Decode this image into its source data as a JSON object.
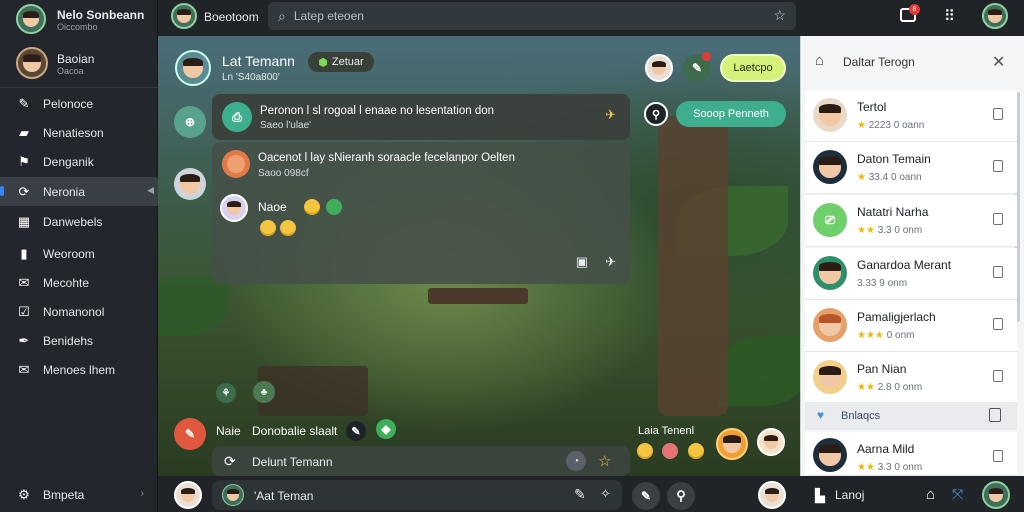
{
  "sidebar": {
    "user": {
      "name": "Nelo Sonbeann",
      "status": "Oiccombo"
    },
    "profile2": {
      "name": "Baoian",
      "sub": "Oacoa"
    },
    "items": [
      {
        "label": "Pelonoce",
        "icon": "feather-icon"
      },
      {
        "label": "Nenatieson",
        "icon": "folder-icon"
      },
      {
        "label": "Denganik",
        "icon": "flag-icon"
      },
      {
        "label": "Neronia",
        "icon": "refresh-icon"
      },
      {
        "label": "Danwebels",
        "icon": "grid-icon"
      },
      {
        "label": "Weoroom",
        "icon": "bookmark-icon"
      },
      {
        "label": "Mecohte",
        "icon": "mail-icon"
      },
      {
        "label": "Nomanonol",
        "icon": "check-icon"
      },
      {
        "label": "Benidehs",
        "icon": "pen-icon"
      },
      {
        "label": "Menoes lhem",
        "icon": "mail-icon"
      }
    ],
    "footer": {
      "label": "Bmpeta"
    }
  },
  "topbar": {
    "user": "Boeotoom",
    "search_placeholder": "Latep eteoen",
    "notification_count": "8"
  },
  "scene": {
    "header": {
      "title": "Lat Temann",
      "subtitle": "Ln 'S40a800'",
      "badge": "Zetuar"
    },
    "action_button": "Laetcpo",
    "secondary_pill": "Sooop Penneth",
    "card1": {
      "title": "Peronon l sl rogoal  l enaae no lesentation don",
      "sub": "Saeo l'ulae'"
    },
    "card2": {
      "title": "Oacenot l lay  sNieranh soraacle fecelanpor Oelten",
      "sub": "Saoo 098cf"
    },
    "card2_emoji_label": "Naoe",
    "chat_row": {
      "name": "Naie",
      "message": "Donobalie slaalt"
    },
    "reply_box": "Delunt Temann",
    "right_label": "Laia Tenenl"
  },
  "rightpanel": {
    "title": "Daltar Terogn",
    "items": [
      {
        "name": "Tertol",
        "stat": "2223 0 oann"
      },
      {
        "name": "Daton Temain",
        "stat": "33.4 0 oann"
      },
      {
        "name": "Natatri Narha",
        "stat": "3.3 0 onm"
      },
      {
        "name": "Ganardoa Merant",
        "stat": "3.33 9 onm"
      },
      {
        "name": "Pamaligjerlach",
        "stat": "0 onm"
      },
      {
        "name": "Pan Nian",
        "stat": "2.8 0 onm"
      }
    ],
    "section": "Bnlaqcs",
    "item7": {
      "name": "Aarna Mild",
      "stat": "3.3 0 onm"
    }
  },
  "bottombar": {
    "composer": "'Aat Teman",
    "right_label": "Lanoj"
  },
  "colors": {
    "accent_green": "#7ed957",
    "accent_teal": "#3fae8e",
    "sidebar": "#23272d",
    "alert_red": "#e53935"
  }
}
